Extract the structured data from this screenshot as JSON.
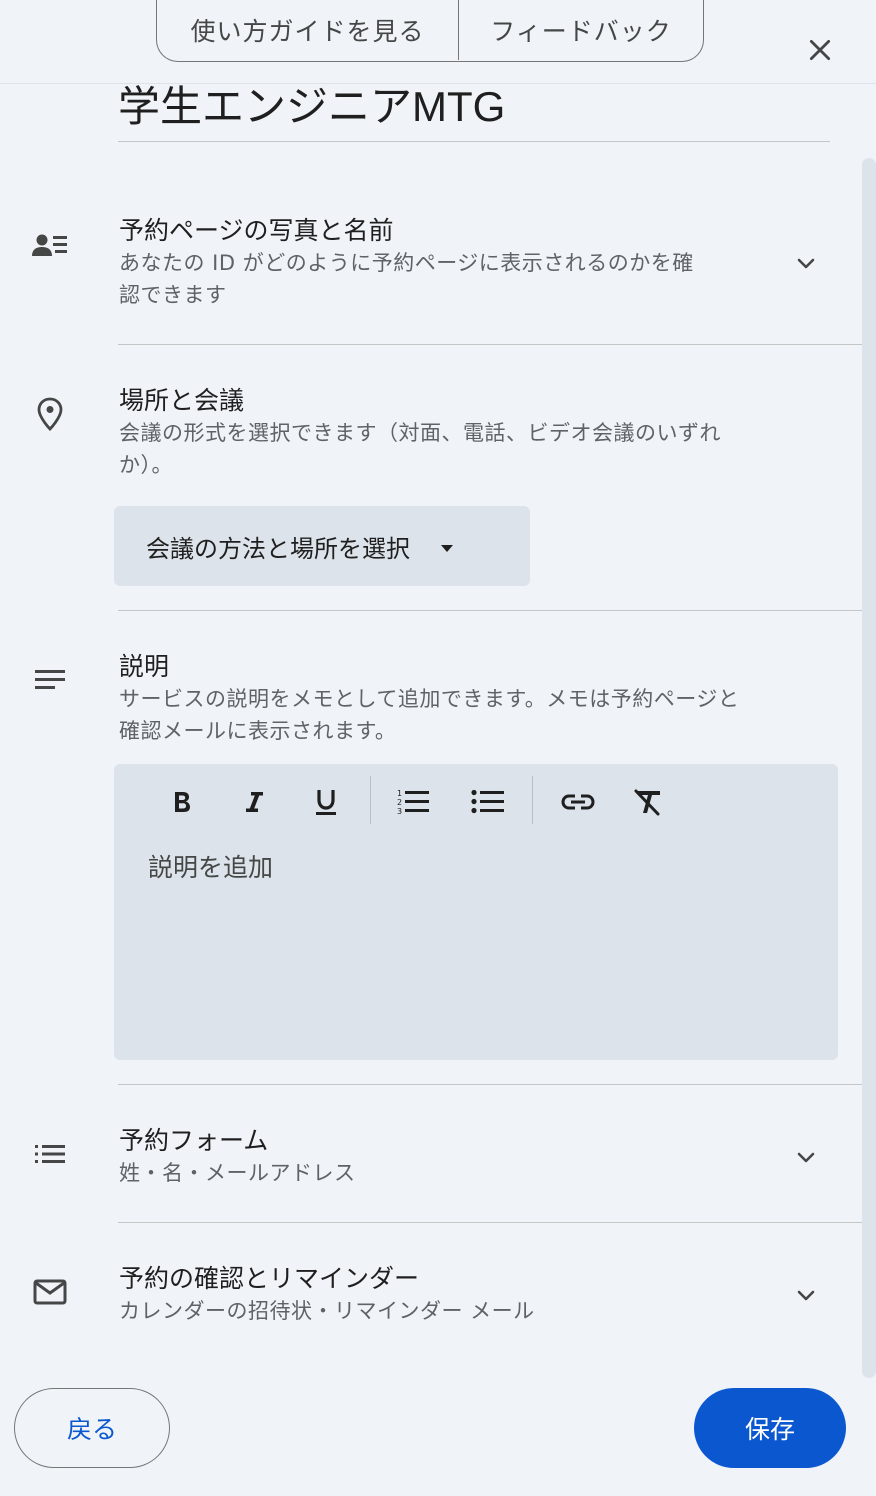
{
  "header": {
    "guide_label": "使い方ガイドを見る",
    "feedback_label": "フィードバック"
  },
  "title": "学生エンジニアMTG",
  "sections": {
    "profile": {
      "title": "予約ページの写真と名前",
      "desc_line1": "あなたの ID がどのように予約ページに表示されるのかを確",
      "desc_line2": "認できます"
    },
    "location": {
      "title": "場所と会議",
      "desc_line1": "会議の形式を選択できます（対面、電話、ビデオ会議のいずれ",
      "desc_line2": "か）。",
      "select_label": "会議の方法と場所を選択"
    },
    "description": {
      "title": "説明",
      "desc_line1": "サービスの説明をメモとして追加できます。メモは予約ページと",
      "desc_line2": "確認メールに表示されます。",
      "placeholder": "説明を追加"
    },
    "booking_form": {
      "title": "予約フォーム",
      "desc": "姓・名・メールアドレス"
    },
    "confirmation": {
      "title": "予約の確認とリマインダー",
      "desc": "カレンダーの招待状・リマインダー メール"
    }
  },
  "footer": {
    "back_label": "戻る",
    "save_label": "保存"
  },
  "colors": {
    "background": "#f0f4f9",
    "primary": "#0b57d0",
    "field_bg": "#dde3ea"
  },
  "icons": {
    "close": "close-icon",
    "profile": "person-list-icon",
    "location": "location-pin-icon",
    "description": "notes-icon",
    "form": "list-icon",
    "confirmation": "mail-icon"
  }
}
